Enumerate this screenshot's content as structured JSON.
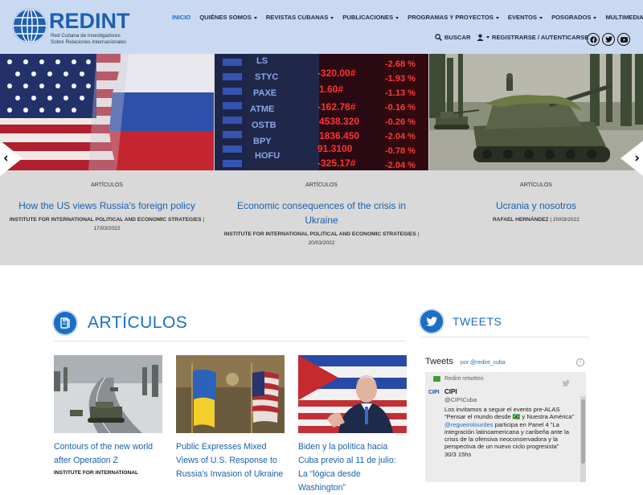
{
  "header": {
    "logo_text": "REDINT",
    "logo_subtitle_line1": "Red Cubana de Investigadores",
    "logo_subtitle_line2": "Sobre Relaciones Internacionales",
    "nav": [
      {
        "label": "INICIO",
        "active": true,
        "dropdown": false
      },
      {
        "label": "QUIÉNES SOMOS",
        "active": false,
        "dropdown": true
      },
      {
        "label": "REVISTAS CUBANAS",
        "active": false,
        "dropdown": true
      },
      {
        "label": "PUBLICACIONES",
        "active": false,
        "dropdown": true
      },
      {
        "label": "PROGRAMAS Y PROYECTOS",
        "active": false,
        "dropdown": true
      },
      {
        "label": "EVENTOS",
        "active": false,
        "dropdown": true
      },
      {
        "label": "POSGRADOS",
        "active": false,
        "dropdown": true
      },
      {
        "label": "MULTIMEDIA",
        "active": false,
        "dropdown": true
      }
    ],
    "search_label": "BUSCAR",
    "login_label": "REGISTRARSE / AUTENTICARSE",
    "socials": [
      "facebook-icon",
      "twitter-icon",
      "youtube-icon"
    ]
  },
  "slider": {
    "slides": [
      {
        "category": "ARTÍCULOS",
        "title": "How the US views Russia's foreign policy",
        "author": "INSTITUTE FOR INTERNATIONAL POLITICAL AND ECONOMIC STRATEGIES",
        "date": "17/03/2022"
      },
      {
        "category": "ARTÍCULOS",
        "title": "Economic consequences of the crisis in Ukraine",
        "author": "INSTITUTE FOR INTERNATIONAL POLITICAL AND ECONOMIC STRATEGIES",
        "date": "20/03/2022"
      },
      {
        "category": "ARTÍCULOS",
        "title": "Ucrania y nosotros",
        "author": "RAFAEL HERNÁNDEZ",
        "date": "20/03/2022"
      }
    ],
    "ticker_values": [
      "-2.68 %",
      "-1.93 %",
      "-1.13 %",
      "-0.16 %",
      "-0.26 %",
      "-2.04 %",
      "-0.78 %",
      "-2.04 %"
    ],
    "ticker_prices": [
      "-320.00#",
      "-162.78#",
      "91.3100",
      "-325.17#"
    ]
  },
  "articles": {
    "section_title": "ARTÍCULOS",
    "cards": [
      {
        "title": "Contours of the new world after Operation Z",
        "author": "INSTITUTE FOR INTERNATIONAL"
      },
      {
        "title": "Public Expresses Mixed Views of U.S. Response to Russia's Invasion of Ukraine",
        "author": ""
      },
      {
        "title": "Biden y la política hacia Cuba previo al 11 de julio: La “lógica desde Washington”",
        "author": ""
      }
    ]
  },
  "tweets": {
    "section_title": "TWEETS",
    "widget_title": "Tweets",
    "by_label": "por",
    "by_handle": "@redint_cuba",
    "retweet_label": "Redint retwitteó",
    "name": "CIPI",
    "handle": "@CIPICuba",
    "avatar_text": "CIPI",
    "text_line1": "Los invitamos a seguir el evento pre-ALAS “Pensar el mundo desde 🇧🇷 y Nuestra América”",
    "mention": "@regueirolourdes",
    "text_line2": "participa en Panel 4 “La integración latinoamericana y caribeña ante la crisis de la ofensiva neoconservadora y la perspectiva de un nuevo ciclo progresista”",
    "date_line": "30/3 15hs"
  },
  "colors": {
    "header_bg": "#c9d9f2",
    "accent": "#1a6fc4",
    "slider_bg": "#d9d9d9"
  }
}
